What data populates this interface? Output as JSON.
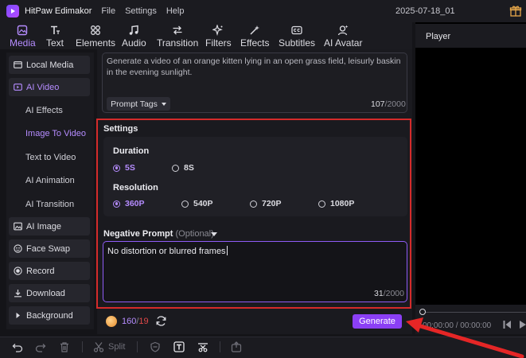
{
  "app": {
    "name": "HitPaw Edimakor",
    "menu": [
      "File",
      "Settings",
      "Help"
    ],
    "project": "2025-07-18_01"
  },
  "tabs": [
    {
      "label": "Media",
      "icon": "media-icon",
      "active": true
    },
    {
      "label": "Text",
      "icon": "text-icon"
    },
    {
      "label": "Elements",
      "icon": "elements-icon"
    },
    {
      "label": "Audio",
      "icon": "music-note-icon"
    },
    {
      "label": "Transition",
      "icon": "transition-icon"
    },
    {
      "label": "Filters",
      "icon": "sparkle-icon"
    },
    {
      "label": "Effects",
      "icon": "magic-wand-icon"
    },
    {
      "label": "Subtitles",
      "icon": "subtitles-icon"
    },
    {
      "label": "AI Avatar",
      "icon": "avatar-icon"
    }
  ],
  "sidebar": {
    "local_media": "Local Media",
    "ai_video": "AI Video",
    "sub_items": [
      "AI Effects",
      "Image To Video",
      "Text to Video",
      "AI Animation",
      "AI Transition"
    ],
    "ai_image": "AI Image",
    "face_swap": "Face Swap",
    "record": "Record",
    "download": "Download",
    "background": "Background"
  },
  "prompt": {
    "text": "Generate a video of an orange kitten lying in an open grass field, leisurly baskin in the evening sunlight.",
    "tags_label": "Prompt Tags",
    "count": "107",
    "max": "/2000"
  },
  "settings": {
    "title": "Settings",
    "duration_label": "Duration",
    "duration_options": [
      "5S",
      "8S"
    ],
    "duration_selected": "5S",
    "resolution_label": "Resolution",
    "resolution_options": [
      "360P",
      "540P",
      "720P",
      "1080P"
    ],
    "resolution_selected": "360P"
  },
  "negative": {
    "label": "Negative Prompt",
    "optional": "(Optional)",
    "text": "No distortion or blurred frames",
    "count": "31",
    "max": "/2000"
  },
  "credits": {
    "balance": "160",
    "separator": "/",
    "cost": "19"
  },
  "generate_label": "Generate",
  "player": {
    "title": "Player",
    "timecode": "00:00:00 / 00:00:00"
  },
  "bottom": {
    "split_label": "Split"
  },
  "colors": {
    "accent": "#b58cff",
    "button": "#8b3ff5",
    "highlight_frame": "#d42b2b"
  }
}
